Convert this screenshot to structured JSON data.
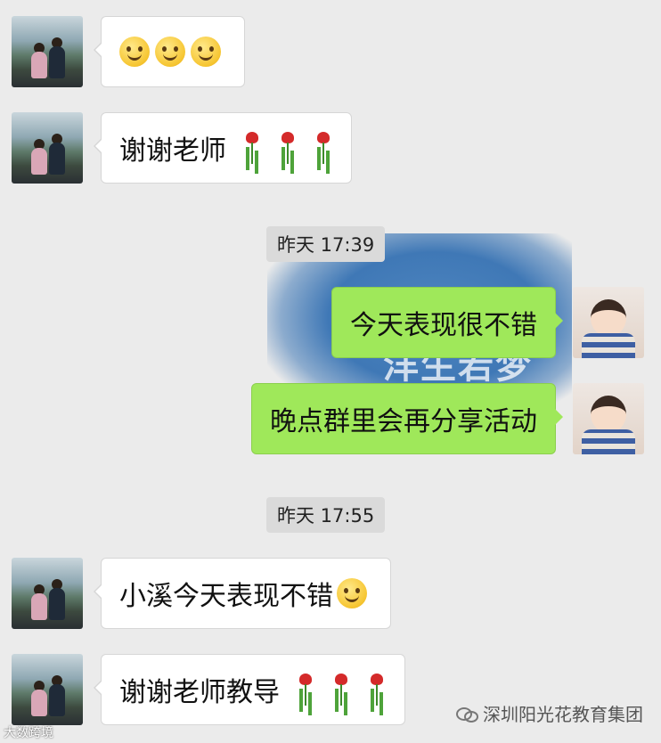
{
  "messages": [
    {
      "side": "left",
      "text": "",
      "emojis": [
        "smile",
        "smile",
        "smile"
      ]
    },
    {
      "side": "left",
      "text": "谢谢老师",
      "emojis": [
        "rose",
        "rose",
        "rose"
      ]
    },
    {
      "side": "right",
      "text": "今天表现很不错"
    },
    {
      "side": "right",
      "text": "晚点群里会再分享活动"
    },
    {
      "side": "left",
      "text": "小溪今天表现不错",
      "emojis": [
        "blush"
      ]
    },
    {
      "side": "left",
      "text": "谢谢老师教导",
      "emojis": [
        "rose",
        "rose",
        "rose"
      ]
    }
  ],
  "timestamps": [
    "昨天 17:39",
    "昨天 17:55"
  ],
  "background_text": "洋生若梦",
  "watermark": "深圳阳光花教育集团",
  "corner_mark": "大数跨境",
  "colors": {
    "sent_bubble": "#9fe85a",
    "received_bubble": "#ffffff",
    "background": "#ebebeb",
    "timestamp_bg": "#dadada"
  }
}
